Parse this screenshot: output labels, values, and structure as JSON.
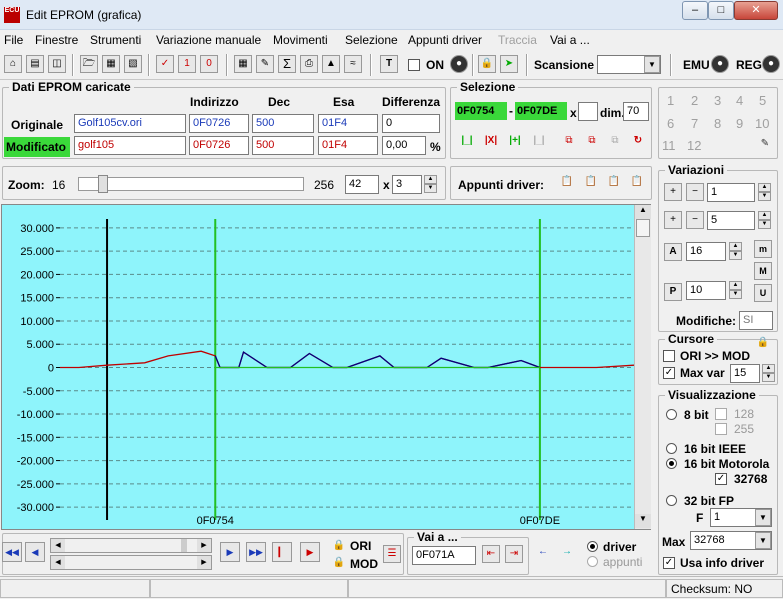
{
  "window": {
    "title": "Edit EPROM (grafica)",
    "icon_text": "ECU"
  },
  "menu": [
    "File",
    "Finestre",
    "Strumenti",
    "Variazione manuale",
    "Movimenti",
    "Selezione",
    "Appunti driver",
    "Traccia",
    "Vai a ..."
  ],
  "toolbar": {
    "on_label": "ON",
    "scansione_label": "Scansione",
    "scansione_value": "",
    "emu_label": "EMU",
    "reg_label": "REG"
  },
  "dati": {
    "title": "Dati EPROM caricate",
    "col_indirizzo": "Indirizzo",
    "col_dec": "Dec",
    "col_esa": "Esa",
    "col_diff": "Differenza",
    "originale_label": "Originale",
    "modificato_label": "Modificato",
    "orig_file": "Golf105cv.ori",
    "orig_addr": "0F0726",
    "orig_dec": "500",
    "orig_esa": "01F4",
    "orig_diff": "0",
    "mod_file": "golf105",
    "mod_addr": "0F0726",
    "mod_dec": "500",
    "mod_esa": "01F4",
    "mod_diff": "0,00",
    "pct": "%"
  },
  "selezione": {
    "title": "Selezione",
    "start": "0F0754",
    "end": "0F07DE",
    "x_label": "x",
    "x_value": "",
    "dim_label": "dim.",
    "dim_value": "70",
    "dash": "-"
  },
  "numpad": [
    "1",
    "2",
    "3",
    "4",
    "5",
    "6",
    "7",
    "8",
    "9",
    "10",
    "11",
    "12"
  ],
  "zoom": {
    "label": "Zoom:",
    "min": "16",
    "max": "256",
    "value": "42",
    "x_label": "x",
    "mult": "3",
    "zoom_fraction": 0.09
  },
  "appunti": {
    "label": "Appunti driver:"
  },
  "variazioni": {
    "title": "Variazioni",
    "v1": "1",
    "v2": "5",
    "a_val": "16",
    "p_val": "10",
    "modifiche_label": "Modifiche:",
    "modifiche_value": "SI"
  },
  "cursore": {
    "title": "Cursore",
    "ori_mod": "ORI >> MOD",
    "max_var_label": "Max var",
    "max_var_value": "15"
  },
  "visualizzazione": {
    "title": "Visualizzazione",
    "bit8": "8 bit",
    "v128": "128",
    "v255": "255",
    "ieee": "16 bit IEEE",
    "motorola": "16 bit Motorola",
    "v32768": "32768",
    "fp": "32 bit FP",
    "f_label": "F",
    "f_value": "1",
    "max_label": "Max",
    "max_value": "32768",
    "usa_info": "Usa info driver"
  },
  "vai_a": {
    "title": "Vai a ...",
    "value": "0F071A"
  },
  "bottom": {
    "ori": "ORI",
    "mod": "MOD",
    "driver": "driver",
    "appunti": "appunti"
  },
  "status": {
    "checksum": "Checksum: NO"
  },
  "colors": {
    "chart_bg": "#8ef4fb",
    "original": "#c00000",
    "modified": "#000080",
    "marker": "#22c022",
    "cursor": "#000000"
  },
  "chart_data": {
    "type": "line",
    "ylim": [
      -32768,
      32768
    ],
    "ytick_labels": [
      "30.000",
      "25.000",
      "20.000",
      "15.000",
      "10.000",
      "5.000",
      "0",
      "-5.000",
      "-10.000",
      "-15.000",
      "-20.000",
      "-25.000",
      "-30.000"
    ],
    "ytick_values": [
      30000,
      25000,
      20000,
      15000,
      10000,
      5000,
      0,
      -5000,
      -10000,
      -15000,
      -20000,
      -25000,
      -30000
    ],
    "x_labels": [
      "0F0754",
      "0F07DE"
    ],
    "markers": [
      "0F0754",
      "0F07DE"
    ],
    "x_domain": [
      "0F0712",
      "0F0806"
    ],
    "cursor_address": "0F0726",
    "series": [
      {
        "x": [
          "0F0712",
          "0F071A",
          "0F0726",
          "0F0736",
          "0F0740",
          "0F074E",
          "0F0754",
          "0F0756",
          "0F075E",
          "0F0760",
          "0F076A",
          "0F0774",
          "0F077C",
          "0F0786",
          "0F078C",
          "0F079A",
          "0F07A0",
          "0F07AE",
          "0F07B4",
          "0F07C2",
          "0F07C8",
          "0F07D6",
          "0F07DE",
          "0F07E8",
          "0F07F6",
          "0F0806"
        ],
        "y": [
          0,
          0,
          500,
          1000,
          2500,
          3500,
          2500,
          0,
          0,
          3300,
          0,
          0,
          3000,
          0,
          0,
          2500,
          0,
          0,
          2000,
          0,
          0,
          1500,
          0,
          0,
          0,
          500
        ]
      },
      {
        "x": [
          "0F0754",
          "0F0756",
          "0F075E",
          "0F0760",
          "0F076A",
          "0F0774",
          "0F077C",
          "0F0786",
          "0F078C",
          "0F079A",
          "0F07A0",
          "0F07AE",
          "0F07B4",
          "0F07C2",
          "0F07C8",
          "0F07D6",
          "0F07DE"
        ],
        "y": [
          2500,
          0,
          0,
          3300,
          0,
          0,
          3000,
          0,
          0,
          2500,
          0,
          0,
          2000,
          0,
          0,
          1500,
          0
        ]
      }
    ]
  }
}
